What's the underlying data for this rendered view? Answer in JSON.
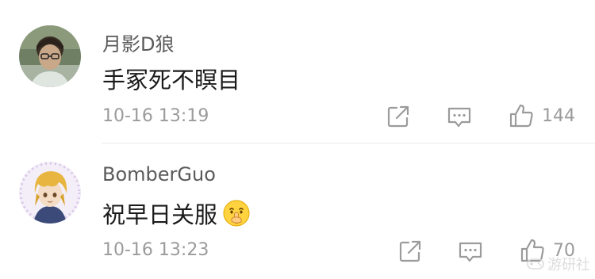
{
  "comments": [
    {
      "username": "月影D狼",
      "content": "手冢死不瞑目",
      "timestamp": "10-16 13:19",
      "likes": "144",
      "avatar_icon": "avatar-photo-person-glasses"
    },
    {
      "username": "BomberGuo",
      "content": "祝早日关服",
      "emoji": "shush-face-emoji",
      "timestamp": "10-16 13:23",
      "likes": "70",
      "avatar_icon": "avatar-anime-character"
    }
  ],
  "icons": {
    "share": "share-icon",
    "reply": "reply-icon",
    "like": "thumbs-up-icon"
  },
  "watermark": {
    "text": "游研社"
  },
  "colors": {
    "username": "#5a5a5a",
    "content": "#1a1a1a",
    "meta": "#9b9b9b",
    "divider": "#ececec"
  }
}
